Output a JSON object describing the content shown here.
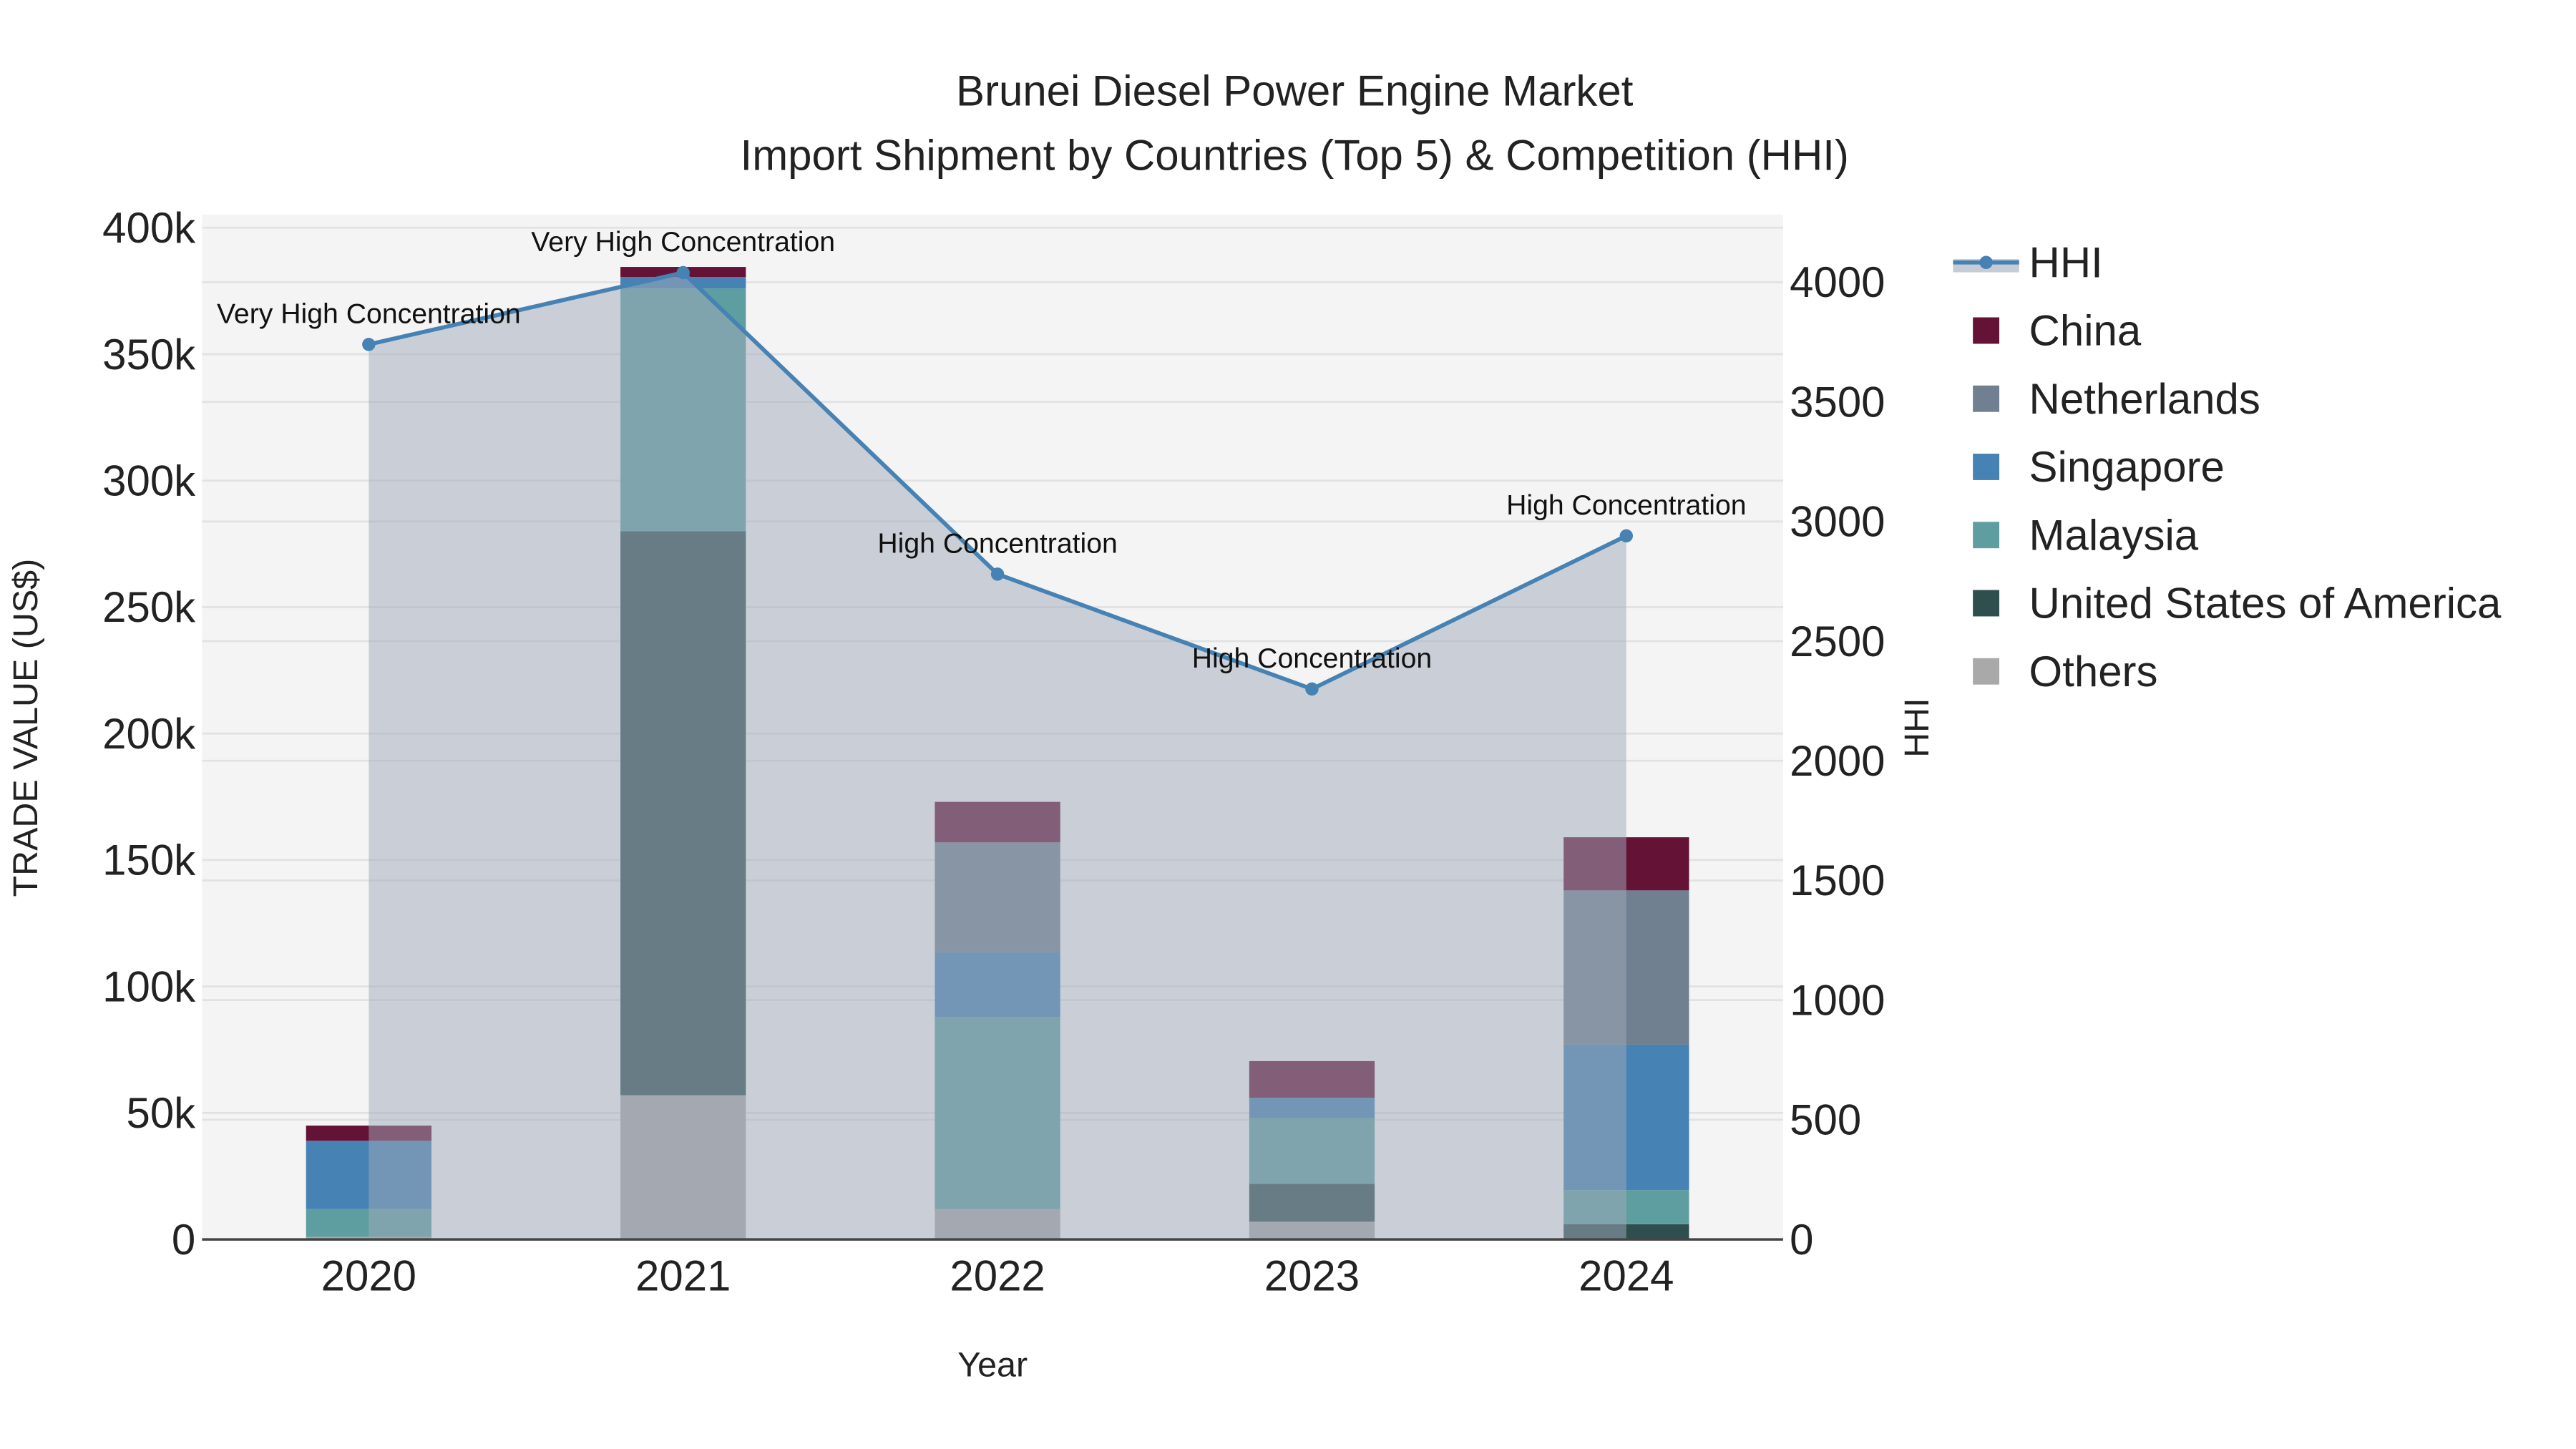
{
  "chart_data": {
    "type": "bar",
    "title": "Brunei Diesel Power Engine Market",
    "subtitle": "Import Shipment by Countries (Top 5) & Competition (HHI)",
    "xlabel": "Year",
    "ylabel": "TRADE VALUE (US$)",
    "y2label": "HHI",
    "categories": [
      "2020",
      "2021",
      "2022",
      "2023",
      "2024"
    ],
    "ylim": [
      0,
      400000
    ],
    "y2lim": [
      0,
      4000
    ],
    "yticks": [
      0,
      50000,
      100000,
      150000,
      200000,
      250000,
      300000,
      350000,
      400000
    ],
    "ytick_labels": [
      "0",
      "50k",
      "100k",
      "150k",
      "200k",
      "250k",
      "300k",
      "350k",
      "400k"
    ],
    "y2ticks": [
      0,
      500,
      1000,
      1500,
      2000,
      2500,
      3000,
      3500,
      4000
    ],
    "y2tick_labels": [
      "0",
      "500",
      "1000",
      "1500",
      "2000",
      "2500",
      "3000",
      "3500",
      "4000"
    ],
    "legend_position": "right",
    "series": [
      {
        "name": "Others",
        "color": "#A9A9A9",
        "values": [
          1000,
          57000,
          12000,
          7000,
          0
        ]
      },
      {
        "name": "United States of America",
        "color": "#2F4F4F",
        "values": [
          0,
          223000,
          0,
          15000,
          6000
        ]
      },
      {
        "name": "Malaysia",
        "color": "#5F9EA0",
        "values": [
          11000,
          96000,
          76000,
          26000,
          13500
        ]
      },
      {
        "name": "Singapore",
        "color": "#4682B4",
        "values": [
          27000,
          4500,
          25500,
          8000,
          57500
        ]
      },
      {
        "name": "Netherlands",
        "color": "#708090",
        "values": [
          0,
          0,
          43500,
          0,
          61000
        ]
      },
      {
        "name": "China",
        "color": "#641236",
        "values": [
          6000,
          4000,
          16000,
          14500,
          21000
        ]
      }
    ],
    "hhi": {
      "name": "HHI",
      "color": "#4682B4",
      "values": [
        3740,
        4040,
        2780,
        2300,
        2940
      ],
      "annotations": [
        "Very High Concentration",
        "Very High Concentration",
        "High Concentration",
        "High Concentration",
        "High Concentration"
      ]
    },
    "legend_order": [
      "HHI",
      "China",
      "Netherlands",
      "Singapore",
      "Malaysia",
      "United States of America",
      "Others"
    ]
  }
}
